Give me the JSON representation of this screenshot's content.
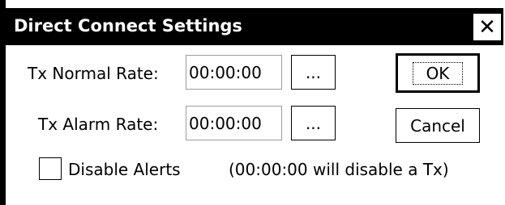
{
  "dialog": {
    "title": "Direct Connect Settings",
    "close_glyph": "✕"
  },
  "tx_normal": {
    "label": "Tx Normal Rate:",
    "value": "00:00:00",
    "browse_label": "..."
  },
  "tx_alarm": {
    "label": "Tx Alarm Rate:",
    "value": "00:00:00",
    "browse_label": "..."
  },
  "disable_alerts": {
    "label": "Disable Alerts",
    "checked": false
  },
  "hint": "(00:00:00 will disable a Tx)",
  "buttons": {
    "ok": "OK",
    "cancel": "Cancel"
  }
}
